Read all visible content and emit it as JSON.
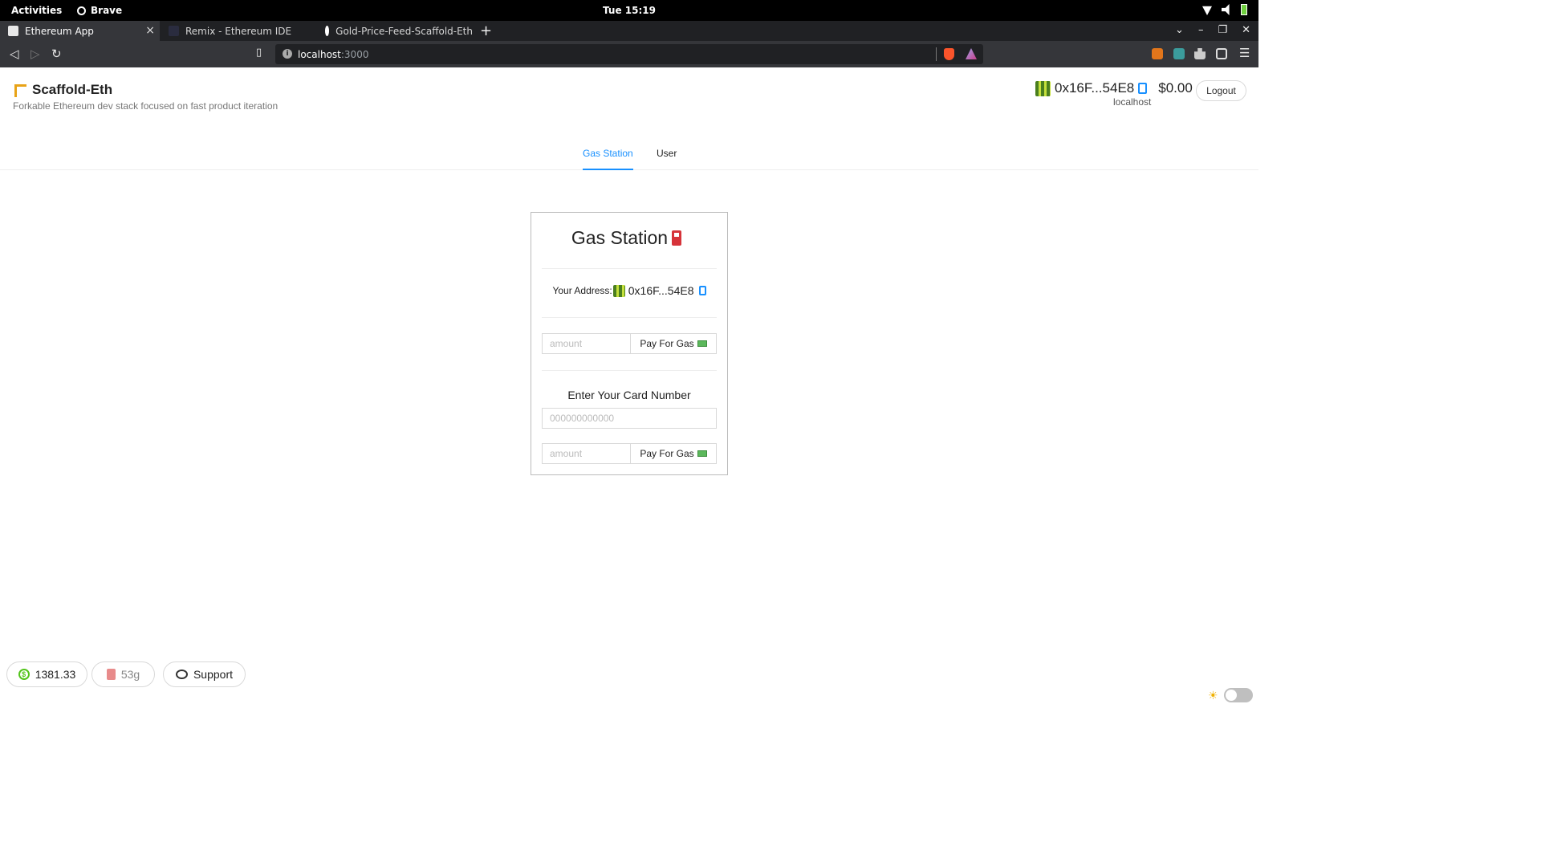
{
  "system": {
    "activities": "Activities",
    "app_name": "Brave",
    "clock": "Tue 15:19"
  },
  "browser": {
    "tabs": [
      {
        "title": "Ethereum App",
        "active": true
      },
      {
        "title": "Remix - Ethereum IDE",
        "active": false
      },
      {
        "title": "Gold-Price-Feed-Scaffold-Eth",
        "active": false
      }
    ],
    "url_host": "localhost",
    "url_port": ":3000"
  },
  "header": {
    "title": "Scaffold-Eth",
    "subtitle": "Forkable Ethereum dev stack focused on fast product iteration",
    "account_address": "0x16F...54E8",
    "balance": "$0.00",
    "network": "localhost",
    "logout_label": "Logout"
  },
  "menu": {
    "items": [
      {
        "label": "Gas Station",
        "active": true
      },
      {
        "label": "User",
        "active": false
      }
    ]
  },
  "card": {
    "title": "Gas Station",
    "address_label": "Your Address:",
    "address": "0x16F...54E8",
    "amount_placeholder": "amount",
    "pay_label": "Pay For Gas",
    "card_label": "Enter Your Card Number",
    "card_placeholder": "000000000000",
    "amount_placeholder_2": "amount",
    "pay_label_2": "Pay For Gas"
  },
  "footer": {
    "eth_price": "1381.33",
    "gas_price": "53g",
    "support_label": "Support"
  },
  "colors": {
    "accent": "#1890ff",
    "chrome_dark": "#202124",
    "chrome_mid": "#35363a"
  }
}
